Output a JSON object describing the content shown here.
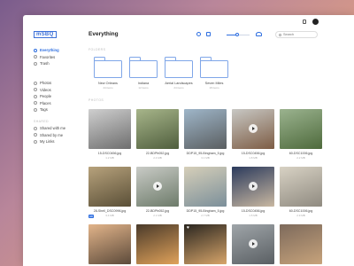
{
  "app": {
    "logo": "mSBQ",
    "title": "Everything"
  },
  "sidebar": {
    "items": [
      {
        "label": "Everything",
        "icon": "grid-icon",
        "active": true
      },
      {
        "label": "Favorites",
        "icon": "heart-icon"
      },
      {
        "label": "Trash",
        "icon": "trash-icon"
      }
    ],
    "media": [
      {
        "label": "Photos",
        "icon": "photo-icon"
      },
      {
        "label": "Videos",
        "icon": "video-icon"
      },
      {
        "label": "People",
        "icon": "people-icon"
      },
      {
        "label": "Places",
        "icon": "pin-icon"
      },
      {
        "label": "Tags",
        "icon": "tag-icon"
      }
    ],
    "shared_label": "SHARED",
    "shared": [
      {
        "label": "Shared with me",
        "icon": "share-icon"
      },
      {
        "label": "Shared by me",
        "icon": "share-icon"
      },
      {
        "label": "My Links",
        "icon": "link-icon"
      }
    ]
  },
  "toolbar": {
    "search_placeholder": "Search",
    "zoom_level": 0.45
  },
  "sections": {
    "folders_label": "FOLDERS",
    "photos_label": "PHOTOS"
  },
  "folders": [
    {
      "name": "New Orleans",
      "count": "44 items"
    },
    {
      "name": "Indiana",
      "count": "12 items"
    },
    {
      "name": "Aerial Landscapes",
      "count": "24 items"
    },
    {
      "name": "Seven Miles",
      "count": "18 items"
    }
  ],
  "photos": [
    {
      "file": "15-DSC0456.jpg",
      "size": "1.2 MB",
      "video": false,
      "colors": [
        "#cfcfcf",
        "#6e6e6e"
      ]
    },
    {
      "file": "22-BDPb052.jpg",
      "size": "2.4 MB",
      "video": false,
      "colors": [
        "#a7b58a",
        "#4f5e3d"
      ]
    },
    {
      "file": "DDP15_95-Bingham_5.jpg",
      "size": "3.1 MB",
      "video": false,
      "colors": [
        "#9fb6c9",
        "#5a5e60"
      ]
    },
    {
      "file": "15-DSC0456.jpg",
      "size": "1.8 MB",
      "video": true,
      "colors": [
        "#c8c8c4",
        "#7d5c44"
      ]
    },
    {
      "file": "60-DSC1006.jpg",
      "size": "2.2 MB",
      "video": false,
      "colors": [
        "#9bb38f",
        "#4e6a3c"
      ]
    },
    {
      "file": "28-Shell_DSC0996.jpg",
      "size": "3.4 MB",
      "video": false,
      "tag": "HD",
      "colors": [
        "#b7a27c",
        "#5a4f37"
      ]
    },
    {
      "file": "22-BDPb052.jpg",
      "size": "2.1 MB",
      "video": true,
      "colors": [
        "#c9cbc6",
        "#6d7b6a"
      ]
    },
    {
      "file": "DDP15_95-Bingham_5.jpg",
      "size": "2.7 MB",
      "video": false,
      "colors": [
        "#d6cfb9",
        "#7b8f9a"
      ]
    },
    {
      "file": "15-DSC0456.jpg",
      "size": "1.5 MB",
      "video": true,
      "colors": [
        "#2b3a5c",
        "#c9b8a1"
      ]
    },
    {
      "file": "60-DSC1006.jpg",
      "size": "2.9 MB",
      "video": false,
      "colors": [
        "#d8d2c4",
        "#8f8a80"
      ]
    },
    {
      "file": "",
      "size": "",
      "video": false,
      "colors": [
        "#e2b48a",
        "#5c4a3a"
      ]
    },
    {
      "file": "",
      "size": "",
      "video": false,
      "colors": [
        "#4a3a2a",
        "#e0a25a"
      ]
    },
    {
      "file": "",
      "size": "",
      "video": false,
      "heart": true,
      "colors": [
        "#2a2620",
        "#d7a56a"
      ]
    },
    {
      "file": "",
      "size": "",
      "video": true,
      "colors": [
        "#9fa5a9",
        "#5a5f63"
      ]
    },
    {
      "file": "",
      "size": "",
      "video": false,
      "colors": [
        "#7d6a5c",
        "#c7a37b"
      ]
    }
  ]
}
